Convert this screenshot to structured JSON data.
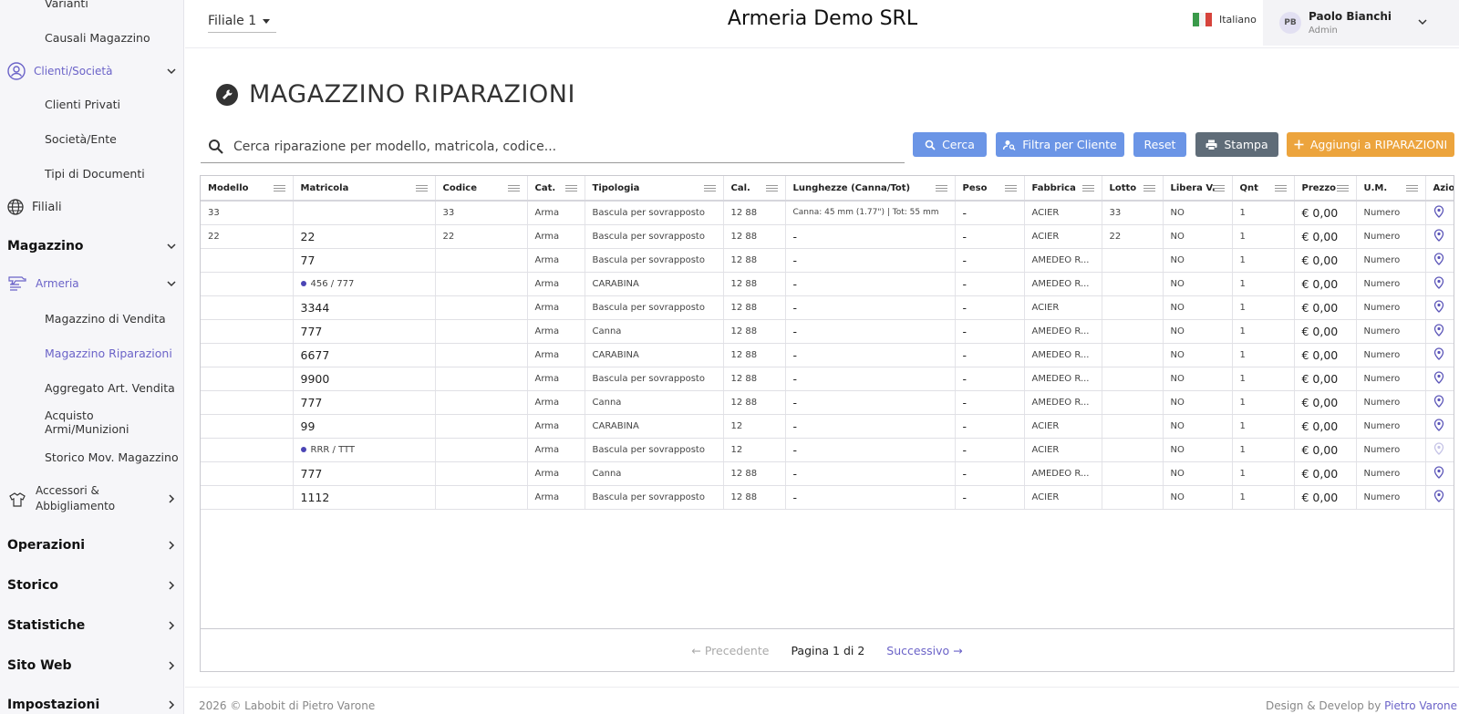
{
  "sidebar": {
    "varianti": "Varianti",
    "causali": "Causali Magazzino",
    "clienti_group": "Clienti/Società",
    "clienti_privati": "Clienti Privati",
    "societa": "Società/Ente",
    "tipi_documenti": "Tipi di Documenti",
    "filiali": "Filiali",
    "magazzino": "Magazzino",
    "armeria": "Armeria",
    "mag_vendita": "Magazzino di Vendita",
    "mag_riparazioni": "Magazzino Riparazioni",
    "aggregato": "Aggregato Art. Vendita",
    "acquisto": "Acquisto Armi/Munizioni",
    "storico_mov": "Storico Mov. Magazzino",
    "accessori": "Accessori &",
    "abbigliamento": "Abbigliamento",
    "operazioni": "Operazioni",
    "storico": "Storico",
    "statistiche": "Statistiche",
    "sito_web": "Sito Web",
    "impostazioni": "Impostazioni"
  },
  "header": {
    "branch": "Filiale 1",
    "company": "Armeria Demo SRL",
    "language": "Italiano",
    "user_initials": "PB",
    "user_name": "Paolo Bianchi",
    "user_role": "Admin"
  },
  "page": {
    "title": "MAGAZZINO RIPARAZIONI",
    "search_placeholder": "Cerca riparazione per modello, matricola, codice..."
  },
  "toolbar": {
    "search": "Cerca",
    "filter_client": "Filtra per Cliente",
    "reset": "Reset",
    "print": "Stampa",
    "add": "Aggiungi a RIPARAZIONI"
  },
  "table": {
    "headers": [
      "Modello",
      "Matricola",
      "Codice",
      "Cat.",
      "Tipologia",
      "Cal.",
      "Lunghezze (Canna/Tot)",
      "Peso",
      "Fabbrica",
      "Lotto",
      "Libera V.",
      "Qnt",
      "Prezzo",
      "U.M.",
      "Azio"
    ],
    "rows": [
      [
        "33",
        "",
        "33",
        "Arma",
        "Bascula per sovrapposto",
        "12 88",
        "Canna: 45 mm (1.77\") | Tot: 55 mm",
        "-",
        "ACIER",
        "33",
        "NO",
        "1",
        "€ 0,00",
        "Numero"
      ],
      [
        "22",
        "22",
        "22",
        "Arma",
        "Bascula per sovrapposto",
        "12 88",
        "-",
        "-",
        "ACIER",
        "22",
        "NO",
        "1",
        "€ 0,00",
        "Numero"
      ],
      [
        "",
        "77",
        "",
        "Arma",
        "Bascula per sovrapposto",
        "12 88",
        "-",
        "-",
        "AMEDEO R...",
        "",
        "NO",
        "1",
        "€ 0,00",
        "Numero"
      ],
      [
        "",
        "456 / 777",
        "",
        "Arma",
        "CARABINA",
        "12 88",
        "-",
        "-",
        "AMEDEO R...",
        "",
        "NO",
        "1",
        "€ 0,00",
        "Numero"
      ],
      [
        "",
        "3344",
        "",
        "Arma",
        "Bascula per sovrapposto",
        "12 88",
        "-",
        "-",
        "ACIER",
        "",
        "NO",
        "1",
        "€ 0,00",
        "Numero"
      ],
      [
        "",
        "777",
        "",
        "Arma",
        "Canna",
        "12 88",
        "-",
        "-",
        "AMEDEO R...",
        "",
        "NO",
        "1",
        "€ 0,00",
        "Numero"
      ],
      [
        "",
        "6677",
        "",
        "Arma",
        "CARABINA",
        "12 88",
        "-",
        "-",
        "AMEDEO R...",
        "",
        "NO",
        "1",
        "€ 0,00",
        "Numero"
      ],
      [
        "",
        "9900",
        "",
        "Arma",
        "Bascula per sovrapposto",
        "12 88",
        "-",
        "-",
        "AMEDEO R...",
        "",
        "NO",
        "1",
        "€ 0,00",
        "Numero"
      ],
      [
        "",
        "777",
        "",
        "Arma",
        "Canna",
        "12 88",
        "-",
        "-",
        "AMEDEO R...",
        "",
        "NO",
        "1",
        "€ 0,00",
        "Numero"
      ],
      [
        "",
        "99",
        "",
        "Arma",
        "CARABINA",
        "12",
        "-",
        "-",
        "ACIER",
        "",
        "NO",
        "1",
        "€ 0,00",
        "Numero"
      ],
      [
        "",
        "RRR / TTT",
        "",
        "Arma",
        "Bascula per sovrapposto",
        "12",
        "-",
        "-",
        "ACIER",
        "",
        "NO",
        "1",
        "€ 0,00",
        "Numero"
      ],
      [
        "",
        "777",
        "",
        "Arma",
        "Canna",
        "12 88",
        "-",
        "-",
        "AMEDEO R...",
        "",
        "NO",
        "1",
        "€ 0,00",
        "Numero"
      ],
      [
        "",
        "1112",
        "",
        "Arma",
        "Bascula per sovrapposto",
        "12 88",
        "-",
        "-",
        "ACIER",
        "",
        "NO",
        "1",
        "€ 0,00",
        "Numero"
      ]
    ]
  },
  "pagination": {
    "prev": "← Precedente",
    "info": "Pagina 1 di 2",
    "next": "Successivo →"
  },
  "footer": {
    "copyright": "2026 © Labobit di Pietro Varone",
    "credit_prefix": "Design & Develop by",
    "credit_name": "Pietro Varone"
  },
  "colors": {
    "accent": "#6b63c8",
    "primary_button": "#6b95e6",
    "print_button": "#5f6c78",
    "add_button": "#eca43d"
  }
}
